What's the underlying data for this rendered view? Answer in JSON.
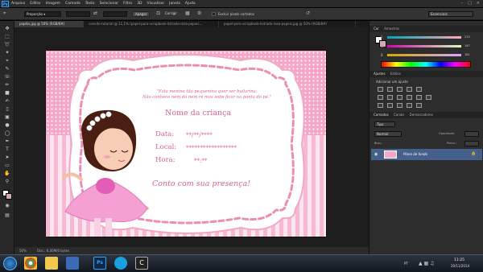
{
  "app": {
    "logo": "Ps"
  },
  "menu": [
    "Arquivo",
    "Editar",
    "Imagem",
    "Camada",
    "Texto",
    "Selecionar",
    "Filtro",
    "3D",
    "Visualizar",
    "Janela",
    "Ajuda"
  ],
  "options": {
    "aspect_value": "Proporção",
    "clear_label": "Apagar",
    "straighten_label": "Corrigir",
    "delete_cropped_label": "Excluir pixels cortados",
    "workspace_value": "Essenciais"
  },
  "tabs": [
    "papéis.jpg @ 50% (RGB/8#)",
    "convite-tutorial @ 11,1% (papel-para-scrapbook-listrado-rosa-papeis...",
    "papel-para-scrapbook-listrado-rosa-papeis.jpg @ 50% (RGB/8#)"
  ],
  "invite": {
    "quote_line1": "\"Esta menina tão pequenina quer ser bailarina.",
    "quote_line2": "Não conhece nem dó nem ré mas sabe ficar na ponta do pé.\"",
    "name": "Nome da criança",
    "date_label": "Data:",
    "date_value": "**/**/****",
    "place_label": "Local:",
    "place_value": "******************",
    "time_label": "Hora:",
    "time_value": "**:**",
    "closing": "Conto com sua presença!"
  },
  "status": {
    "zoom": "50%",
    "doc": "Doc.: 6,00M/0 bytes"
  },
  "panels": {
    "color_tabs": [
      "Cor",
      "Amostras"
    ],
    "rgb": [
      {
        "label": "R",
        "value": "215"
      },
      {
        "label": "G",
        "value": "167"
      },
      {
        "label": "B",
        "value": "181"
      }
    ],
    "adjust_tabs": [
      "Ajustes",
      "Estilos"
    ],
    "adjust_title": "Adicionar um ajuste",
    "layer_tabs": [
      "Camadas",
      "Canais",
      "Demarcadores"
    ],
    "layer_kind": "Tipo",
    "blend_mode": "Normal",
    "opacity_label": "Opacidade:",
    "lock_label": "Bloq.:",
    "fill_label": "Preen.:",
    "layer_name": "Plano de fundo"
  },
  "taskbar": {
    "lang": "PT",
    "time": "11:25",
    "date": "20/11/2014"
  },
  "colors": {
    "accent": "#e0608f",
    "fg_swatch": "#ffffff",
    "bg_swatch": "#d7a7b5"
  }
}
